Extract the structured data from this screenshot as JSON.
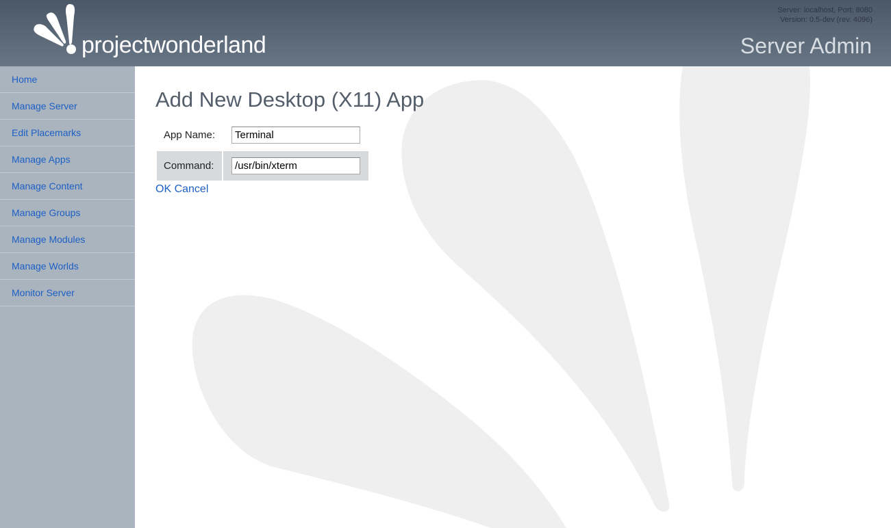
{
  "header": {
    "logo_text": "projectwonderland",
    "server_line": "Server: localhost, Port: 8080",
    "version_line": "Version: 0.5-dev (rev. 4096)",
    "title": "Server Admin"
  },
  "sidebar": {
    "items": [
      {
        "label": "Home"
      },
      {
        "label": "Manage Server"
      },
      {
        "label": "Edit Placemarks"
      },
      {
        "label": "Manage Apps"
      },
      {
        "label": "Manage Content"
      },
      {
        "label": "Manage Groups"
      },
      {
        "label": "Manage Modules"
      },
      {
        "label": "Manage Worlds"
      },
      {
        "label": "Monitor Server"
      }
    ]
  },
  "main": {
    "heading": "Add New Desktop (X11) App",
    "fields": [
      {
        "label": "App Name:",
        "value": "Terminal"
      },
      {
        "label": "Command:",
        "value": "/usr/bin/xterm"
      }
    ],
    "ok_label": "OK",
    "cancel_label": "Cancel"
  }
}
